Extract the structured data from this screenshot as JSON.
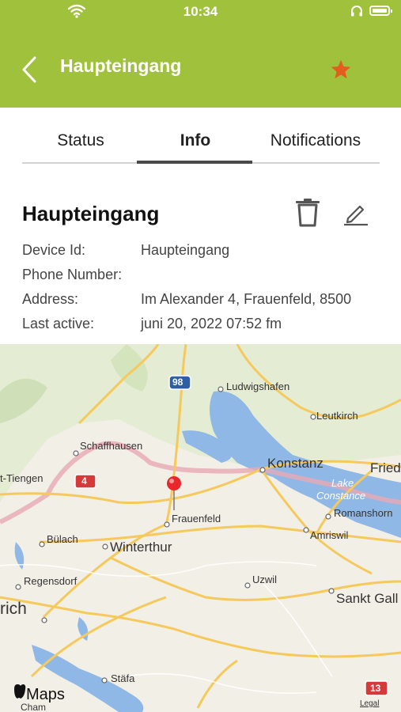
{
  "status_bar": {
    "time": "10:34"
  },
  "header": {
    "title": "Haupteingang"
  },
  "tabs": [
    {
      "label": "Status"
    },
    {
      "label": "Info"
    },
    {
      "label": "Notifications"
    }
  ],
  "info": {
    "title": "Haupteingang",
    "fields": [
      {
        "label": "Device Id:",
        "value": "Haupteingang"
      },
      {
        "label": "Phone Number:",
        "value": ""
      },
      {
        "label": "Address:",
        "value": "Im Alexander 4, Frauenfeld, 8500"
      },
      {
        "label": "Last active:",
        "value": "juni 20, 2022 07:52 fm"
      }
    ]
  },
  "map": {
    "labels": {
      "ludwigshafen": "Ludwigshafen",
      "leutkirch": "Leutkirch",
      "schaffhausen": "Schaffhausen",
      "tiengen": "t-Tiengen",
      "konstanz": "Konstanz",
      "friedrichshafen": "Fried",
      "lake": "Lake",
      "constance": "Constance",
      "romanshorn": "Romanshorn",
      "frauenfeld": "Frauenfeld",
      "amriswil": "Amriswil",
      "bulach": "Bülach",
      "winterthur": "Winterthur",
      "regensdorf": "Regensdorf",
      "uzwil": "Uzwil",
      "sankt_gallen": "Sankt Gall",
      "zurich": "rich",
      "stafa": "Stäfa",
      "cham": "Cham",
      "legal": "Legal"
    },
    "route_shields": {
      "a": "98",
      "b": "4",
      "c": "13"
    },
    "attribution": "Maps"
  },
  "colors": {
    "header": "#a0c13c",
    "star": "#e35d1f",
    "pin": "#e8262b",
    "water": "#8fb8e6",
    "road": "#f5c95c"
  }
}
